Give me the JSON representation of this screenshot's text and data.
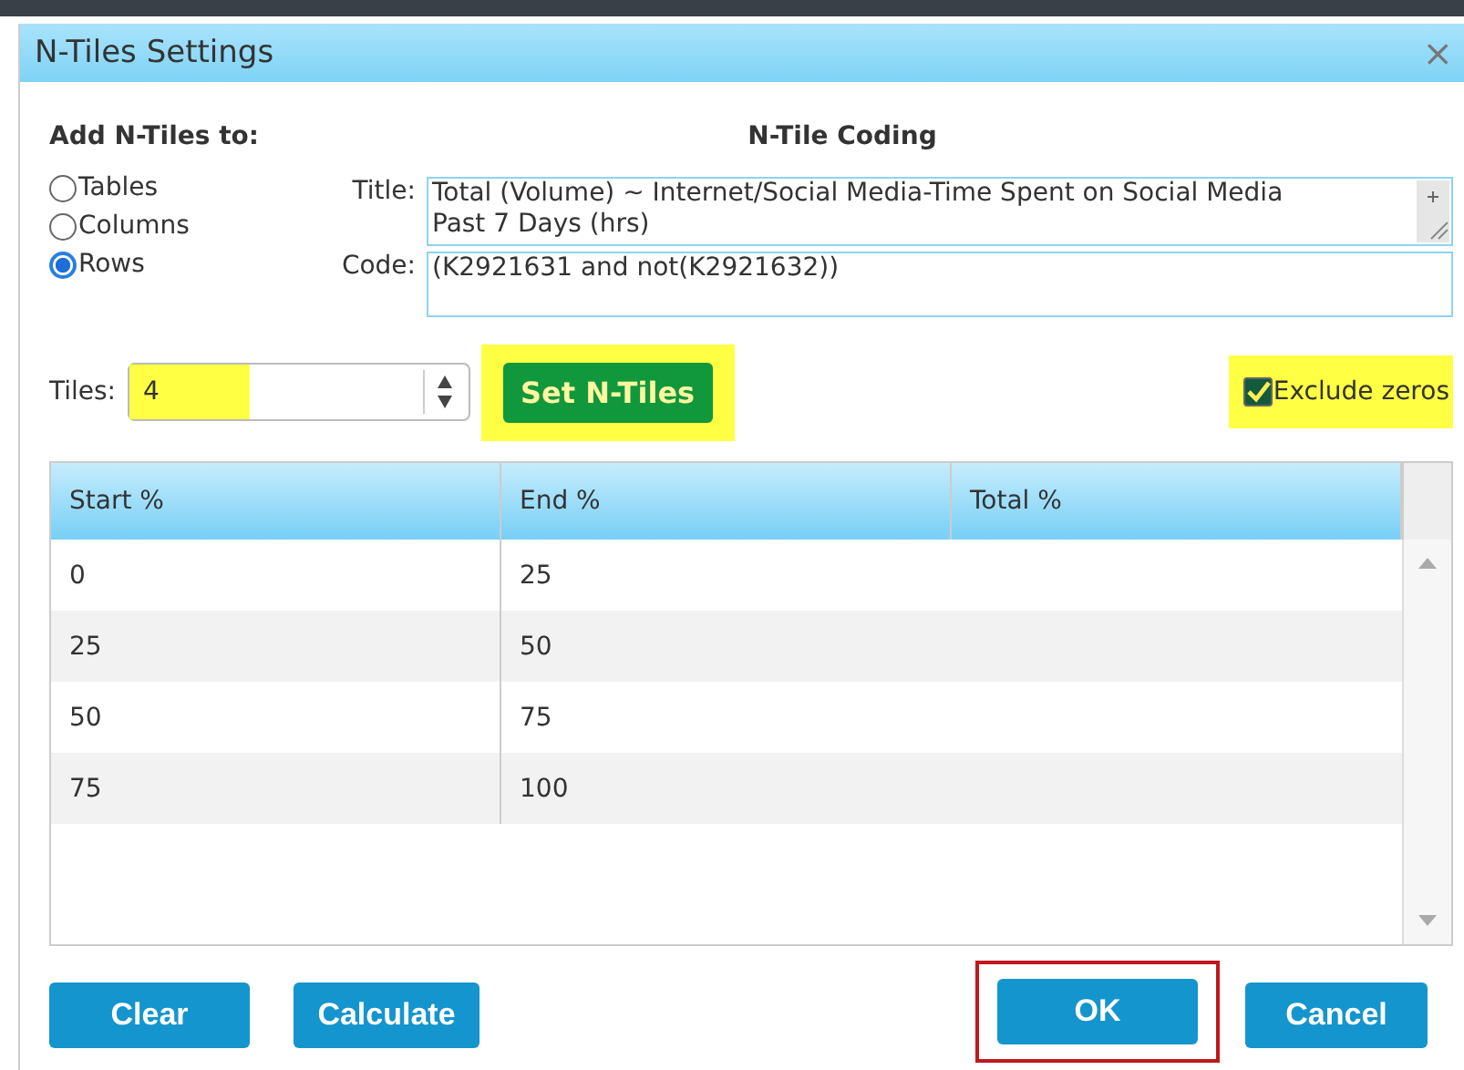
{
  "window": {
    "title": "N-Tiles Settings",
    "close": "×"
  },
  "add_to": {
    "label": "Add N-Tiles to:",
    "options": [
      {
        "label": "Tables",
        "selected": false
      },
      {
        "label": "Columns",
        "selected": false
      },
      {
        "label": "Rows",
        "selected": true
      }
    ]
  },
  "coding": {
    "heading": "N-Tile Coding",
    "title_label": "Title:",
    "title_value": "Total (Volume) ~ Internet/Social Media-Time Spent on Social Media Past 7 Days (hrs)",
    "code_label": "Code:",
    "code_value": "(K2921631 and not(K2921632))"
  },
  "tiles": {
    "label": "Tiles:",
    "value": "4",
    "highlighted": true
  },
  "set_button": {
    "label": "Set N-Tiles",
    "highlighted": true
  },
  "exclude_zeros": {
    "label": "Exclude zeros",
    "checked": true,
    "highlighted": true
  },
  "table": {
    "columns": [
      "Start %",
      "End %",
      "Total %"
    ],
    "rows": [
      [
        "0",
        "25",
        ""
      ],
      [
        "25",
        "50",
        ""
      ],
      [
        "50",
        "75",
        ""
      ],
      [
        "75",
        "100",
        ""
      ]
    ]
  },
  "buttons": [
    {
      "label": "Clear",
      "outlined": false
    },
    {
      "label": "Calculate",
      "outlined": false
    },
    {
      "label": "OK",
      "outlined": true
    },
    {
      "label": "Cancel",
      "outlined": false
    }
  ]
}
